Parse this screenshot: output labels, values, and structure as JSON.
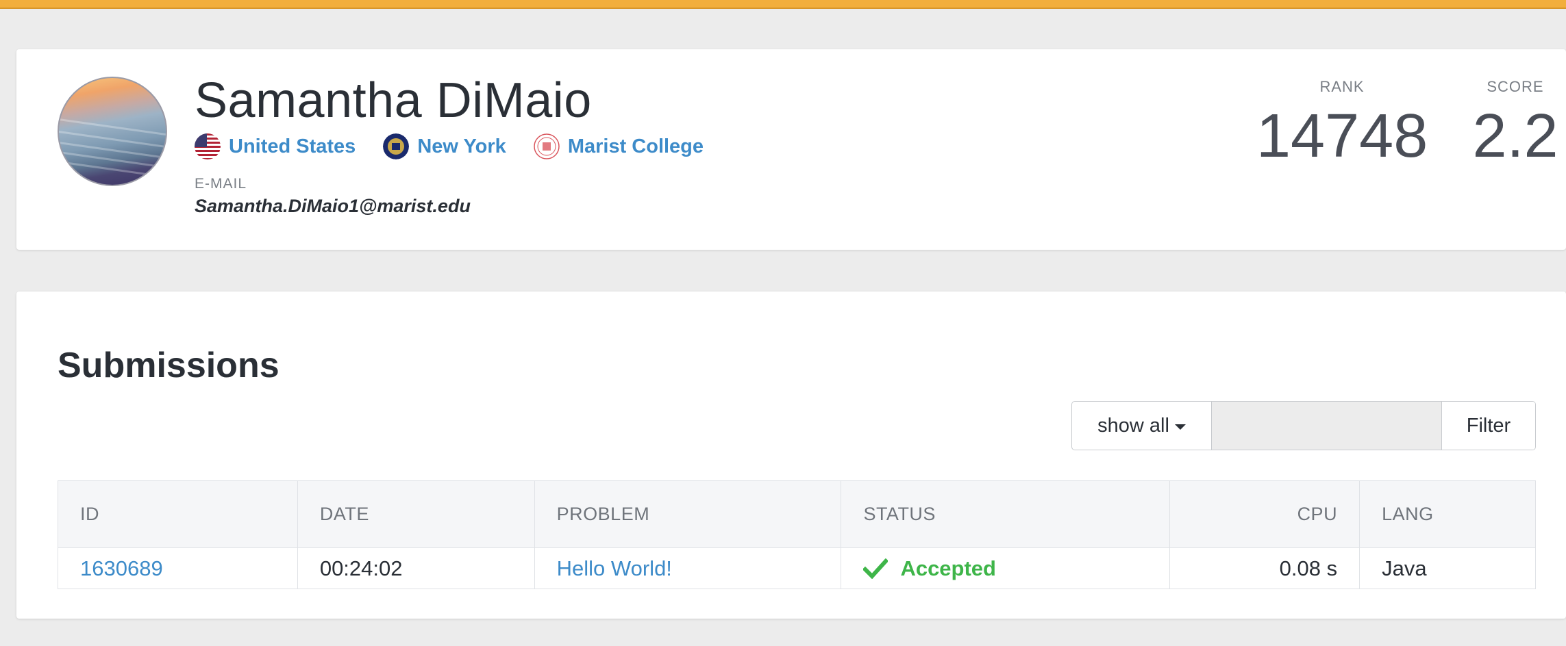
{
  "profile": {
    "name": "Samantha DiMaio",
    "country": "United States",
    "region": "New York",
    "school": "Marist College",
    "email_label": "E-MAIL",
    "email": "Samantha.DiMaio1@marist.edu",
    "rank_label": "RANK",
    "rank": "14748",
    "score_label": "SCORE",
    "score": "2.2"
  },
  "submissions": {
    "title": "Submissions",
    "filter": {
      "select_label": "show all",
      "input_value": "",
      "button_label": "Filter"
    },
    "columns": [
      "ID",
      "DATE",
      "PROBLEM",
      "STATUS",
      "CPU",
      "LANG"
    ],
    "rows": [
      {
        "id": "1630689",
        "date": "00:24:02",
        "problem": "Hello World!",
        "status": "Accepted",
        "cpu": "0.08 s",
        "lang": "Java"
      }
    ]
  },
  "colors": {
    "accent_bar": "#f2ae3d",
    "link": "#3d8bc9",
    "accepted": "#3eb549"
  }
}
